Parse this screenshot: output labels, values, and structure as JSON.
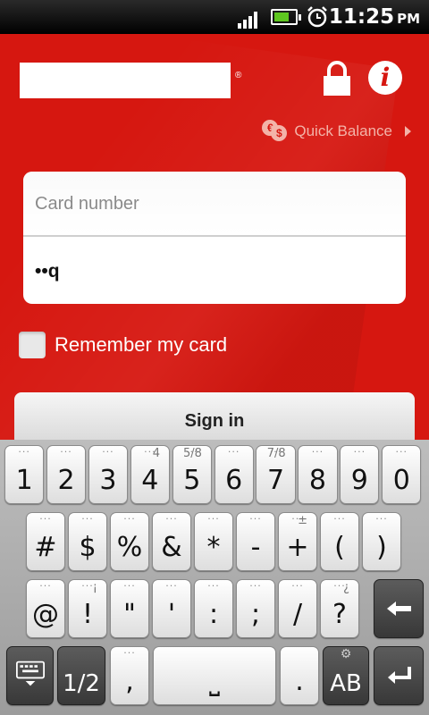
{
  "status_bar": {
    "time": "11:25",
    "ampm": "PM",
    "icons": [
      "signal-icon",
      "battery-icon",
      "alarm-clock-icon"
    ]
  },
  "app": {
    "logo_registered_mark": "®",
    "quick_balance_label": "Quick Balance",
    "card_number_placeholder": "Card number",
    "password_value": "••q",
    "remember_label": "Remember my card",
    "sign_in_label": "Sign in",
    "colors": {
      "background": "#d61710",
      "accent_text": "#f3b3a8"
    }
  },
  "keyboard": {
    "row1": [
      {
        "label": "1",
        "sup": ""
      },
      {
        "label": "2",
        "sup": ""
      },
      {
        "label": "3",
        "sup": ""
      },
      {
        "label": "4",
        "sup": "4"
      },
      {
        "label": "5",
        "sup": "5/8"
      },
      {
        "label": "6",
        "sup": ""
      },
      {
        "label": "7",
        "sup": "7/8"
      },
      {
        "label": "8",
        "sup": ""
      },
      {
        "label": "9",
        "sup": ""
      },
      {
        "label": "0",
        "sup": ""
      }
    ],
    "row2": [
      {
        "label": "#",
        "sup": ""
      },
      {
        "label": "$",
        "sup": ""
      },
      {
        "label": "%",
        "sup": ""
      },
      {
        "label": "&",
        "sup": ""
      },
      {
        "label": "*",
        "sup": ""
      },
      {
        "label": "-",
        "sup": ""
      },
      {
        "label": "+",
        "sup": "±"
      },
      {
        "label": "(",
        "sup": ""
      },
      {
        "label": ")",
        "sup": ""
      }
    ],
    "row3": [
      {
        "label": "@",
        "sup": ""
      },
      {
        "label": "!",
        "sup": "¡"
      },
      {
        "label": "\"",
        "sup": ""
      },
      {
        "label": "'",
        "sup": ""
      },
      {
        "label": ":",
        "sup": ""
      },
      {
        "label": ";",
        "sup": ""
      },
      {
        "label": "/",
        "sup": ""
      },
      {
        "label": "?",
        "sup": "¿"
      }
    ],
    "backspace_icon": "backspace-arrow-icon",
    "page_label": "1/2",
    "comma_label": ",",
    "space_label": "⎵",
    "period_label": ".",
    "ab_label": "AB",
    "enter_icon": "enter-icon",
    "hide_keyboard_icon": "keyboard-hide-icon"
  }
}
